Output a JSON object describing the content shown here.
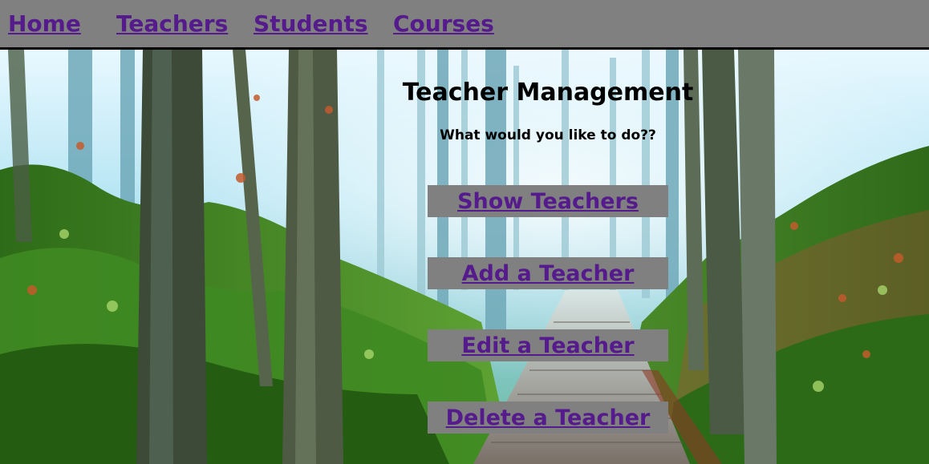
{
  "nav": {
    "home": "Home",
    "teachers": "Teachers",
    "students": "Students",
    "courses": "Courses"
  },
  "main": {
    "title": "Teacher Management",
    "subtitle": "What would you like to do??",
    "actions": {
      "show": "Show Teachers",
      "add": "Add a Teacher",
      "edit": "Edit a Teacher",
      "delete": "Delete a Teacher"
    }
  },
  "colors": {
    "nav_background": "#808080",
    "link": "#551a8b",
    "button_background": "#808080",
    "text": "#000000"
  }
}
